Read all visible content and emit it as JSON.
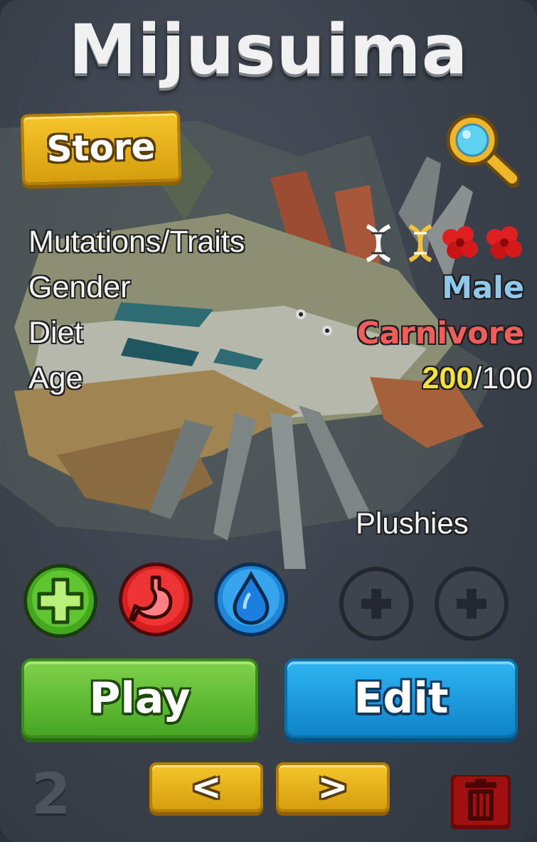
{
  "title": "Mijusuima",
  "store_label": "Store",
  "stats": {
    "traits_label": "Mutations/Traits",
    "gender_label": "Gender",
    "gender_value": "Male",
    "diet_label": "Diet",
    "diet_value": "Carnivore",
    "age_label": "Age",
    "age_current": "200",
    "age_max": "/100"
  },
  "traits_icons": [
    "dna-white-icon",
    "dna-gold-icon",
    "red-flower-icon",
    "red-flower-icon"
  ],
  "plushies_label": "Plushies",
  "actions": {
    "play_label": "Play",
    "edit_label": "Edit"
  },
  "nav": {
    "page_number": "2",
    "prev_label": "<",
    "next_label": ">"
  },
  "icons": {
    "search": "magnifier-icon",
    "heal": "plus-icon",
    "food": "stomach-icon",
    "water": "water-drop-icon",
    "plush_slot": "plus-icon",
    "delete": "trash-icon"
  },
  "colors": {
    "male": "#8ec8ea",
    "carnivore": "#f05d5d",
    "age_current": "#f5e23a",
    "play": "#47a624",
    "edit": "#0f83c9",
    "store": "#d69e0e",
    "trash": "#a01010"
  }
}
